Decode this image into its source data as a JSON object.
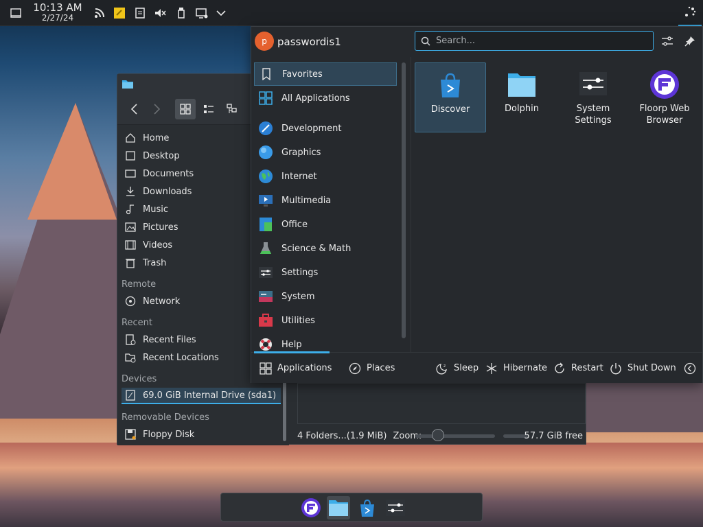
{
  "colors": {
    "accent": "#3daee9",
    "panel": "#1f2226",
    "avatar": "#e5612e"
  },
  "panel": {
    "time": "10:13 AM",
    "date": "2/27/24",
    "tray_icons": [
      "rss-icon",
      "clipboard-notes-icon",
      "notes-icon",
      "muted-speaker-icon",
      "usb-icon",
      "network-icon",
      "chevron-down-icon"
    ]
  },
  "dolphin": {
    "places": {
      "items": [
        "Home",
        "Desktop",
        "Documents",
        "Downloads",
        "Music",
        "Pictures",
        "Videos",
        "Trash"
      ],
      "remote_label": "Remote",
      "remote_items": [
        "Network"
      ],
      "recent_label": "Recent",
      "recent_items": [
        "Recent Files",
        "Recent Locations"
      ],
      "devices_label": "Devices",
      "devices_items": [
        "69.0 GiB Internal Drive (sda1)"
      ],
      "removable_label": "Removable Devices",
      "removable_items": [
        "Floppy Disk"
      ]
    },
    "status": {
      "summary": "4 Folders...(1.9 MiB)",
      "zoom_label": "Zoom:",
      "free": "57.7 GiB free"
    }
  },
  "launcher": {
    "user": {
      "initial": "p",
      "name": "passwordis1"
    },
    "search": {
      "placeholder": "Search..."
    },
    "categories": [
      "Favorites",
      "All Applications",
      "Development",
      "Graphics",
      "Internet",
      "Multimedia",
      "Office",
      "Science & Math",
      "Settings",
      "System",
      "Utilities",
      "Help"
    ],
    "apps": [
      {
        "name": "Discover"
      },
      {
        "name": "Dolphin"
      },
      {
        "name": "System Settings"
      },
      {
        "name": "Floorp Web Browser"
      }
    ],
    "footer": {
      "applications": "Applications",
      "places": "Places",
      "sleep": "Sleep",
      "hibernate": "Hibernate",
      "restart": "Restart",
      "shutdown": "Shut Down"
    }
  }
}
